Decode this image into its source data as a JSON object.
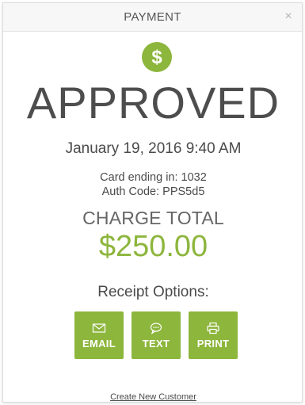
{
  "header": {
    "title": "PAYMENT",
    "close_glyph": "×"
  },
  "status": {
    "icon": "dollar-icon",
    "icon_glyph": "$",
    "text": "APPROVED",
    "datetime": "January 19, 2016 9:40 AM",
    "card_line": "Card ending in: 1032",
    "auth_line": "Auth Code: PPS5d5"
  },
  "charge": {
    "label": "CHARGE TOTAL",
    "amount": "$250.00"
  },
  "receipt": {
    "label": "Receipt Options:",
    "options": [
      {
        "label": "EMAIL",
        "icon": "envelope-icon"
      },
      {
        "label": "TEXT",
        "icon": "chat-bubble-icon"
      },
      {
        "label": "PRINT",
        "icon": "printer-icon"
      }
    ]
  },
  "footer": {
    "create_link": "Create New Customer"
  },
  "colors": {
    "accent": "#8db63d",
    "text": "#4a4a4a",
    "header_bg": "#f7f7f7"
  }
}
